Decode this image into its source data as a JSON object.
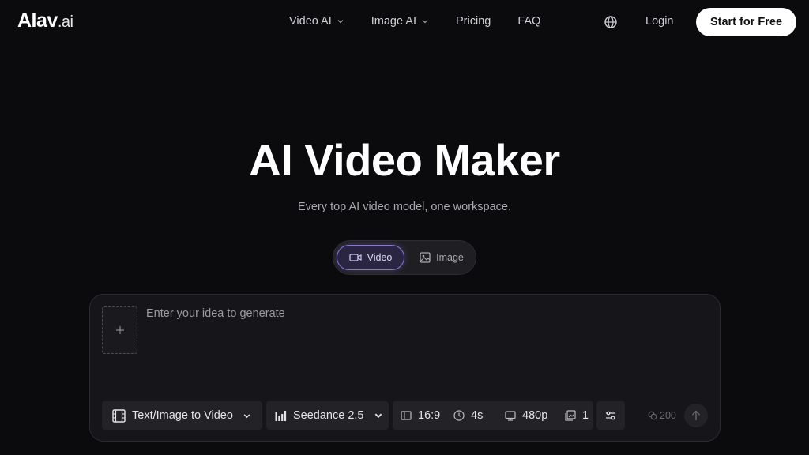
{
  "brand": {
    "name": "Alav",
    "suffix": ".ai"
  },
  "nav": {
    "items": [
      {
        "label": "Video AI",
        "dropdown": true
      },
      {
        "label": "Image AI",
        "dropdown": true
      },
      {
        "label": "Pricing",
        "dropdown": false
      },
      {
        "label": "FAQ",
        "dropdown": false
      }
    ],
    "login_label": "Login",
    "cta_label": "Start for Free",
    "language_icon": "globe-icon"
  },
  "hero": {
    "title": "AI Video Maker",
    "subtitle": "Every top AI video model, one workspace."
  },
  "mode_toggle": {
    "options": [
      {
        "label": "Video",
        "icon": "video-camera-icon",
        "selected": true
      },
      {
        "label": "Image",
        "icon": "image-icon",
        "selected": false
      }
    ]
  },
  "prompt": {
    "placeholder": "Enter your idea to generate",
    "value": "",
    "upload_icon": "plus-icon"
  },
  "toolbar": {
    "mode_label": "Text/Image to Video",
    "model_label": "Seedance 2.5",
    "aspect_ratio": "16:9",
    "duration": "4s",
    "resolution": "480p",
    "count": "1",
    "credits": "200"
  },
  "colors": {
    "background": "#0b0b0d",
    "panel": "#16161a",
    "accent": "#8a74d8",
    "cta_bg": "#ffffff"
  }
}
